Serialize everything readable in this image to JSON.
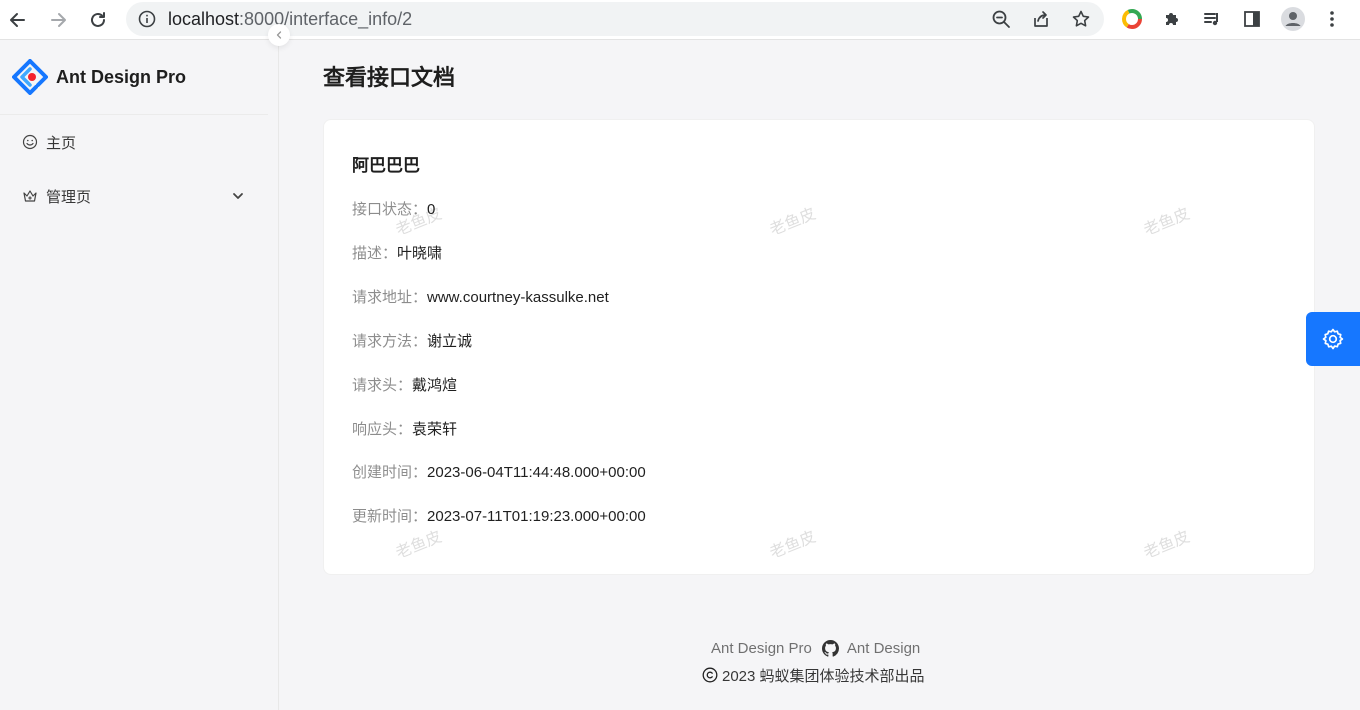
{
  "browser": {
    "url_host": "localhost",
    "url_path": ":8000/interface_info/2"
  },
  "sidebar": {
    "logo_title": "Ant Design Pro",
    "items": [
      {
        "label": "主页",
        "icon": "smile-icon"
      },
      {
        "label": "管理页",
        "icon": "crown-icon"
      }
    ]
  },
  "page": {
    "title": "查看接口文档"
  },
  "card": {
    "title": "阿巴巴巴",
    "fields": [
      {
        "label": "接口状态：",
        "value": "0"
      },
      {
        "label": "描述：",
        "value": "叶晓啸"
      },
      {
        "label": "请求地址：",
        "value": "www.courtney-kassulke.net"
      },
      {
        "label": "请求方法：",
        "value": "谢立诚"
      },
      {
        "label": "请求头：",
        "value": "戴鸿煊"
      },
      {
        "label": "响应头：",
        "value": "袁荣轩"
      },
      {
        "label": "创建时间：",
        "value": "2023-06-04T11:44:48.000+00:00"
      },
      {
        "label": "更新时间：",
        "value": "2023-07-11T01:19:23.000+00:00"
      }
    ],
    "watermark": "老鱼皮"
  },
  "footer": {
    "link1": "Ant Design Pro",
    "link2": "Ant Design",
    "copyright": "2023 蚂蚁集团体验技术部出品"
  },
  "colors": {
    "primary": "#1677ff",
    "background": "#f5f5f7"
  }
}
